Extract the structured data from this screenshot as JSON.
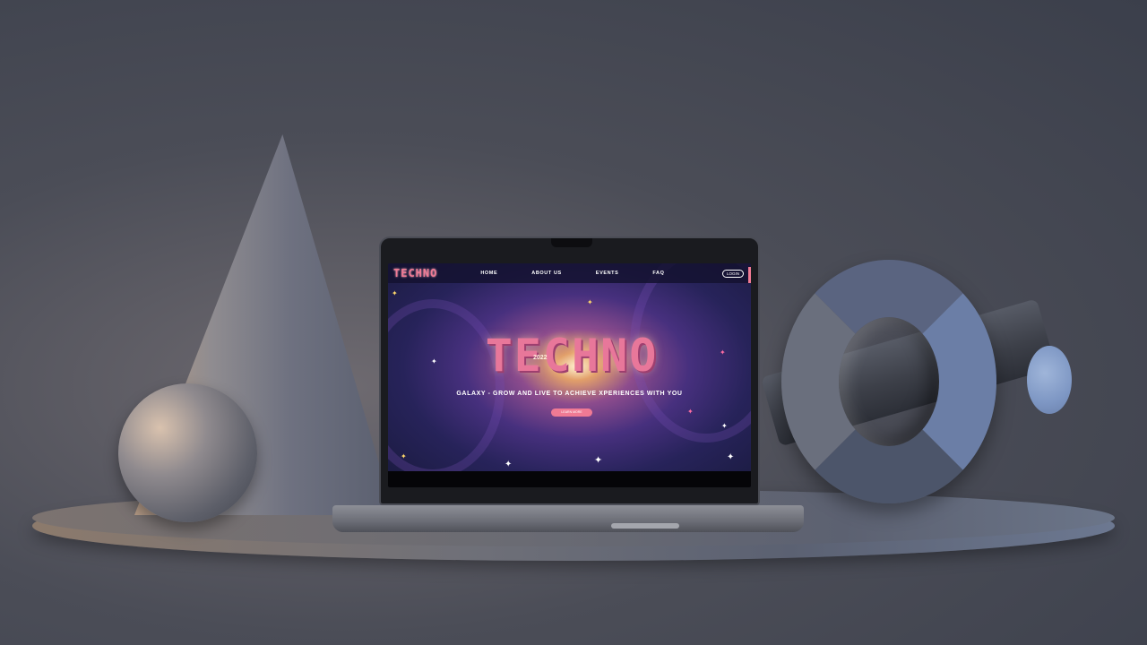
{
  "website": {
    "brand": "TECHNO",
    "nav": {
      "items": [
        "HOME",
        "ABOUT US",
        "EVENTS",
        "FAQ"
      ],
      "login_label": "LOGIN"
    },
    "hero": {
      "title": "TECHNO",
      "year": "2022",
      "subtitle": "GALAXY - GROW AND LIVE TO ACHIEVE XPERIENCES WITH YOU",
      "button_label": "LEARN MORE"
    }
  },
  "colors": {
    "accent": "#f07a94",
    "nav_bg": "#141230",
    "space_bg": "#27235a"
  },
  "icons": [
    "sparkle-star-icon",
    "satellite-icon",
    "rocket-icon"
  ]
}
